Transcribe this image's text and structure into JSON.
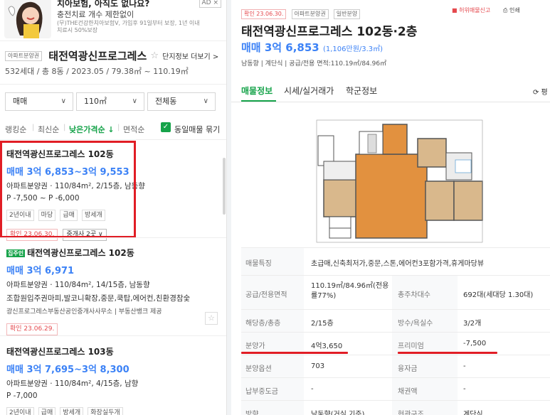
{
  "ad": {
    "title": "치아보험, 아직도 없나요?",
    "subtitle": "충전치료 개수 제한없이",
    "fine": "(무)THE건강한치아보험V, 가입후 91일부터 보장, 1년 이내 치료시 50%보장",
    "badge": "AD ×"
  },
  "complex": {
    "tag": "아파트분양권",
    "name": "태전역광신프로그레스",
    "star": "☆",
    "more": "단지정보 더보기 >",
    "info": "532세대 / 총 8동 / 2023.05 / 79.38㎡ ~ 110.19㎡"
  },
  "filters": [
    {
      "label": "매매"
    },
    {
      "label": "110㎡"
    },
    {
      "label": "전체동"
    }
  ],
  "sort": {
    "items": [
      "랭킹순",
      "최신순",
      "낮은가격순 ↓",
      "면적순"
    ],
    "checkbox_label": "동일매물 묶기"
  },
  "listings": [
    {
      "title": "태전역광신프로그레스 102동",
      "price": "매매 3억 6,853~3억 9,553",
      "line1": "아파트분양권 · 110/84m², 2/15층, 남동향",
      "line2": "P -7,500 ~ P -6,000",
      "chips": [
        "2년이내",
        "마당",
        "급매",
        "방세개"
      ],
      "confirm": "확인 23.06.30.",
      "broker": "중개사 2곳 ∨"
    },
    {
      "direct_tag": "집주인",
      "title": "태전역광신프로그레스 102동",
      "price": "매매 3억 6,971",
      "line1": "아파트분양권 · 110/84m², 14/15층, 남동향",
      "line2": "조합원입주권마피,발코니확장,중문,쿡탑,에어컨,친환경참숯",
      "small": "광신프로그레스부동산공인중개사사무소 | 부동산뱅크 제공",
      "confirm": "확인 23.06.29."
    },
    {
      "title": "태전역광신프로그레스 103동",
      "price": "매매 3억 7,695~3억 8,300",
      "line1": "아파트분양권 · 110/84m², 4/15층, 남향",
      "line2": "P -7,000",
      "chips": [
        "2년이내",
        "급매",
        "방세개",
        "화장실두개"
      ]
    }
  ],
  "detail": {
    "tags": [
      "확인 23.06.30.",
      "아파트분양권",
      "일반분양"
    ],
    "report": "허위매물신고",
    "print": "인쇄",
    "title": "태전역광신프로그레스 102동·2층",
    "price": "매매 3억 6,853",
    "price_unit": "(1,106만원/3.3㎡)",
    "spec": "남동향 | 계단식 | 공급/전용 면적:110.19㎡/84.96㎡",
    "tabs": [
      "매물정보",
      "시세/실거래가",
      "학군정보"
    ],
    "refresh": "⟳ 평",
    "rows": [
      {
        "k1": "매물특징",
        "v1": "초급매,신축최저가,중문,스톤,에어컨3포함가격,휴게마당뷰"
      },
      {
        "k1": "공급/전용면적",
        "v1": "110.19㎡/84.96㎡(전용률77%)",
        "k2": "총주차대수",
        "v2": "692대(세대당 1.30대)"
      },
      {
        "k1": "해당층/총층",
        "v1": "2/15층",
        "k2": "방수/욕실수",
        "v2": "3/2개"
      },
      {
        "k1": "분양가",
        "v1": "4억3,650",
        "k2": "프리미엄",
        "v2": "-7,500"
      },
      {
        "k1": "분양옵션",
        "v1": "703",
        "k2": "융자금",
        "v2": "-"
      },
      {
        "k1": "납부중도금",
        "v1": "-",
        "k2": "채권액",
        "v2": "-"
      },
      {
        "k1": "방향",
        "v1": "남동향(거실 기준)",
        "k2": "현관구조",
        "v2": "계단식"
      }
    ]
  }
}
